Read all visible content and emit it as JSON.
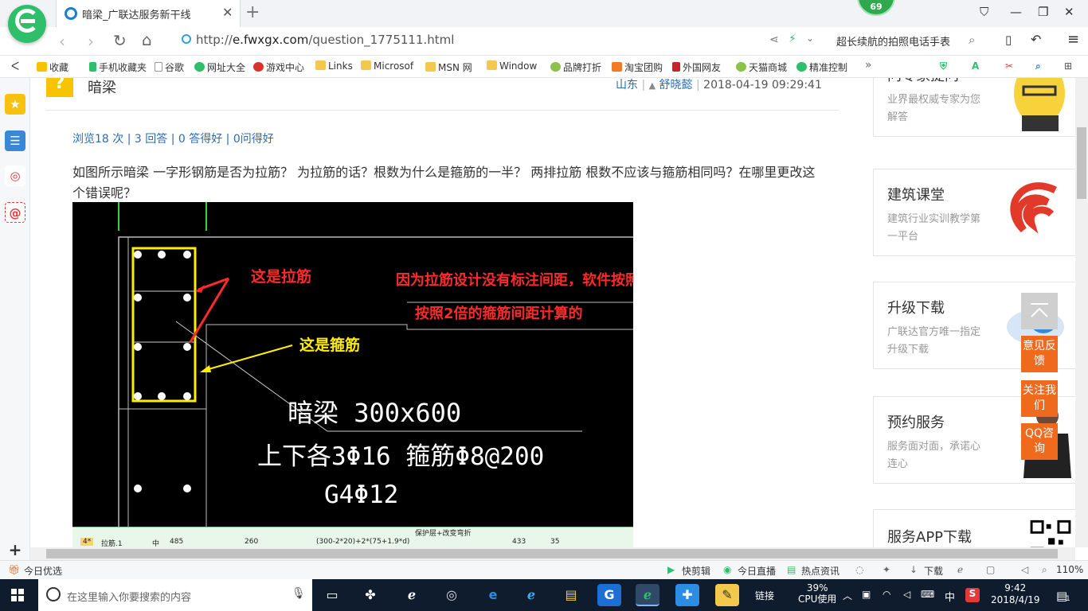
{
  "browser": {
    "tab_title": "暗梁_广联达服务新干线",
    "url_domain": "e.fwxgx.com",
    "url_prefix": "http://",
    "url_path": "/question_1775111.html",
    "search_text": "超长续航的拍照电话手表",
    "badge_count": "69"
  },
  "favorites": [
    "收藏",
    "手机收藏夹",
    "谷歌",
    "网址大全",
    "游戏中心",
    "Links",
    "Microsof",
    "MSN 网",
    "Window",
    "品牌打折",
    "淘宝团购",
    "外国网友",
    "天猫商城",
    "精准控制"
  ],
  "question": {
    "title": "暗梁",
    "location": "山东",
    "author": "舒晓懿",
    "datetime": "2018-04-19 09:29:41",
    "stats": "浏览18 次 | 3 回答 | 0 答得好 | 0问得好",
    "body": "如图所示暗梁    一字形钢筋是否为拉筋？  为拉筋的话？根数为什么是箍筋的一半？   两排拉筋    根数不应该与箍筋相同吗？在哪里更改这个错误呢？"
  },
  "cad": {
    "label_lajin": "这是拉筋",
    "label_gujin": "这是箍筋",
    "note_line1": "因为拉筋设计没有标注间距，软件按照平法的要求",
    "note_line2": "按照2倍的箍筋间距计算的",
    "beam_name": "暗梁 300x600",
    "beam_rebar": "上下各3Φ16  箍筋Φ8@200",
    "beam_side": "G4Φ12"
  },
  "table_strip": {
    "header": "保护层+改变弯折",
    "row_num": "4*",
    "row_name": "拉筋.1",
    "row_dia": "中",
    "row_len": "485",
    "row_shape_len": "260",
    "row_formula": "(300-2*20)+2*(75+1.9*d)",
    "row_total": "433",
    "row_count": "35"
  },
  "sidebar_cards": [
    {
      "title": "问专家提问",
      "desc": "业界最权威专家为您解答"
    },
    {
      "title": "建筑课堂",
      "desc": "建筑行业实训教学第一平台"
    },
    {
      "title": "升级下载",
      "desc": "广联达官方唯一指定升级下载"
    },
    {
      "title": "预约服务",
      "desc": "服务面对面，承诺心连心"
    },
    {
      "title": "服务APP下载",
      "desc": ""
    }
  ],
  "float_buttons": [
    "意见反馈",
    "关注我们",
    "QQ咨询"
  ],
  "statusbar": {
    "left": "今日优选",
    "items": [
      "快剪辑",
      "今日直播",
      "热点资讯",
      "下载"
    ],
    "zoom": "110%"
  },
  "taskbar": {
    "search_placeholder": "在这里输入你要搜索的内容",
    "link_label": "链接",
    "cpu_percent": "39%",
    "cpu_label": "CPU使用",
    "ime": "中",
    "time": "9:42",
    "date": "2018/4/19",
    "notify_count": "1"
  },
  "colors": {
    "brand_green": "#2fbf6a",
    "link_blue": "#2b6cb0",
    "cad_red": "#ff2a2a",
    "cad_yellow": "#ffee00",
    "orange": "#f06a1d"
  }
}
